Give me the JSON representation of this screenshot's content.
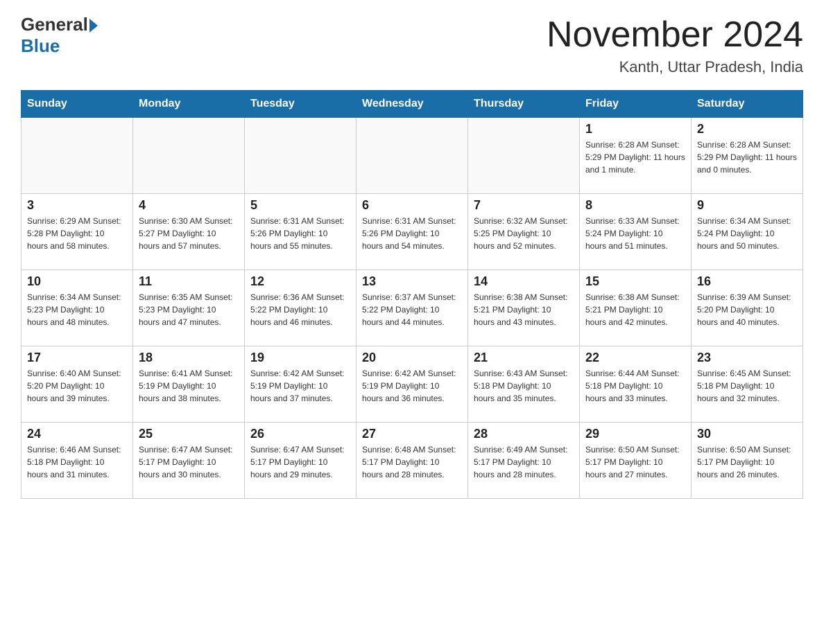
{
  "header": {
    "logo_general": "General",
    "logo_blue": "Blue",
    "month_title": "November 2024",
    "location": "Kanth, Uttar Pradesh, India"
  },
  "days_of_week": [
    "Sunday",
    "Monday",
    "Tuesday",
    "Wednesday",
    "Thursday",
    "Friday",
    "Saturday"
  ],
  "weeks": [
    [
      {
        "day": "",
        "info": ""
      },
      {
        "day": "",
        "info": ""
      },
      {
        "day": "",
        "info": ""
      },
      {
        "day": "",
        "info": ""
      },
      {
        "day": "",
        "info": ""
      },
      {
        "day": "1",
        "info": "Sunrise: 6:28 AM\nSunset: 5:29 PM\nDaylight: 11 hours and 1 minute."
      },
      {
        "day": "2",
        "info": "Sunrise: 6:28 AM\nSunset: 5:29 PM\nDaylight: 11 hours and 0 minutes."
      }
    ],
    [
      {
        "day": "3",
        "info": "Sunrise: 6:29 AM\nSunset: 5:28 PM\nDaylight: 10 hours and 58 minutes."
      },
      {
        "day": "4",
        "info": "Sunrise: 6:30 AM\nSunset: 5:27 PM\nDaylight: 10 hours and 57 minutes."
      },
      {
        "day": "5",
        "info": "Sunrise: 6:31 AM\nSunset: 5:26 PM\nDaylight: 10 hours and 55 minutes."
      },
      {
        "day": "6",
        "info": "Sunrise: 6:31 AM\nSunset: 5:26 PM\nDaylight: 10 hours and 54 minutes."
      },
      {
        "day": "7",
        "info": "Sunrise: 6:32 AM\nSunset: 5:25 PM\nDaylight: 10 hours and 52 minutes."
      },
      {
        "day": "8",
        "info": "Sunrise: 6:33 AM\nSunset: 5:24 PM\nDaylight: 10 hours and 51 minutes."
      },
      {
        "day": "9",
        "info": "Sunrise: 6:34 AM\nSunset: 5:24 PM\nDaylight: 10 hours and 50 minutes."
      }
    ],
    [
      {
        "day": "10",
        "info": "Sunrise: 6:34 AM\nSunset: 5:23 PM\nDaylight: 10 hours and 48 minutes."
      },
      {
        "day": "11",
        "info": "Sunrise: 6:35 AM\nSunset: 5:23 PM\nDaylight: 10 hours and 47 minutes."
      },
      {
        "day": "12",
        "info": "Sunrise: 6:36 AM\nSunset: 5:22 PM\nDaylight: 10 hours and 46 minutes."
      },
      {
        "day": "13",
        "info": "Sunrise: 6:37 AM\nSunset: 5:22 PM\nDaylight: 10 hours and 44 minutes."
      },
      {
        "day": "14",
        "info": "Sunrise: 6:38 AM\nSunset: 5:21 PM\nDaylight: 10 hours and 43 minutes."
      },
      {
        "day": "15",
        "info": "Sunrise: 6:38 AM\nSunset: 5:21 PM\nDaylight: 10 hours and 42 minutes."
      },
      {
        "day": "16",
        "info": "Sunrise: 6:39 AM\nSunset: 5:20 PM\nDaylight: 10 hours and 40 minutes."
      }
    ],
    [
      {
        "day": "17",
        "info": "Sunrise: 6:40 AM\nSunset: 5:20 PM\nDaylight: 10 hours and 39 minutes."
      },
      {
        "day": "18",
        "info": "Sunrise: 6:41 AM\nSunset: 5:19 PM\nDaylight: 10 hours and 38 minutes."
      },
      {
        "day": "19",
        "info": "Sunrise: 6:42 AM\nSunset: 5:19 PM\nDaylight: 10 hours and 37 minutes."
      },
      {
        "day": "20",
        "info": "Sunrise: 6:42 AM\nSunset: 5:19 PM\nDaylight: 10 hours and 36 minutes."
      },
      {
        "day": "21",
        "info": "Sunrise: 6:43 AM\nSunset: 5:18 PM\nDaylight: 10 hours and 35 minutes."
      },
      {
        "day": "22",
        "info": "Sunrise: 6:44 AM\nSunset: 5:18 PM\nDaylight: 10 hours and 33 minutes."
      },
      {
        "day": "23",
        "info": "Sunrise: 6:45 AM\nSunset: 5:18 PM\nDaylight: 10 hours and 32 minutes."
      }
    ],
    [
      {
        "day": "24",
        "info": "Sunrise: 6:46 AM\nSunset: 5:18 PM\nDaylight: 10 hours and 31 minutes."
      },
      {
        "day": "25",
        "info": "Sunrise: 6:47 AM\nSunset: 5:17 PM\nDaylight: 10 hours and 30 minutes."
      },
      {
        "day": "26",
        "info": "Sunrise: 6:47 AM\nSunset: 5:17 PM\nDaylight: 10 hours and 29 minutes."
      },
      {
        "day": "27",
        "info": "Sunrise: 6:48 AM\nSunset: 5:17 PM\nDaylight: 10 hours and 28 minutes."
      },
      {
        "day": "28",
        "info": "Sunrise: 6:49 AM\nSunset: 5:17 PM\nDaylight: 10 hours and 28 minutes."
      },
      {
        "day": "29",
        "info": "Sunrise: 6:50 AM\nSunset: 5:17 PM\nDaylight: 10 hours and 27 minutes."
      },
      {
        "day": "30",
        "info": "Sunrise: 6:50 AM\nSunset: 5:17 PM\nDaylight: 10 hours and 26 minutes."
      }
    ]
  ]
}
